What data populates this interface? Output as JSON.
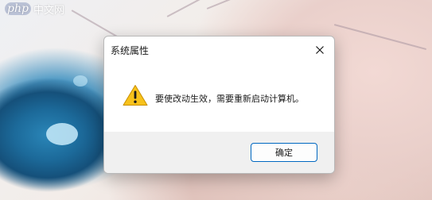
{
  "watermark": {
    "php": "php",
    "site": "中文网"
  },
  "dialog": {
    "title": "系统属性",
    "message": "要使改动生效，需要重新启动计算机。",
    "ok_label": "确定",
    "icon": "warning-icon",
    "close_icon": "close-icon"
  },
  "colors": {
    "accent": "#0067c0",
    "warning_yellow": "#f7c21b",
    "footer_bg": "#f0f0f0"
  }
}
